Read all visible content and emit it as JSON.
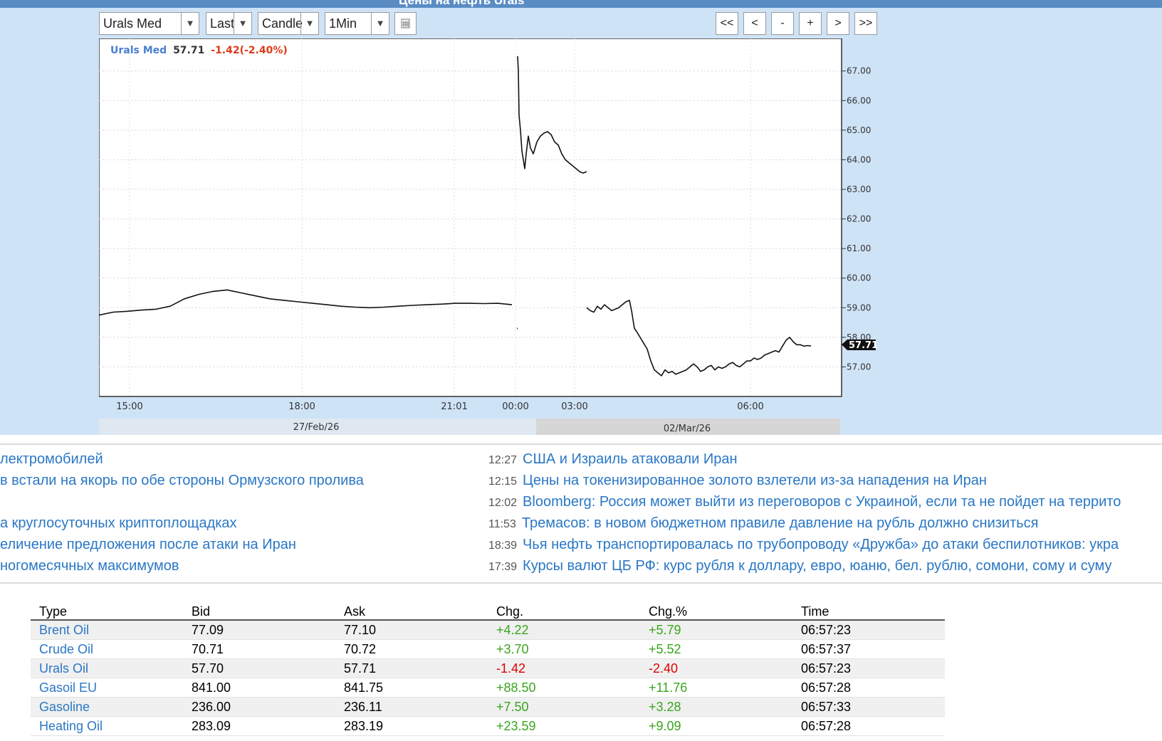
{
  "header": {
    "title": "Цены на нефть Urals"
  },
  "toolbar": {
    "instrument": "Urals Med",
    "price_field": "Last",
    "chart_style": "Candle",
    "interval": "1Min",
    "nav": {
      "first": "<<",
      "prev": "<",
      "zoom_out": "-",
      "zoom_in": "+",
      "next": ">",
      "last": ">>"
    }
  },
  "chart_data": {
    "type": "line",
    "series_name": "Urals Med",
    "last": "57.71",
    "change": "-1.42",
    "change_pct": "(-2.40%)",
    "last_label": "57.71",
    "ylim": [
      56.0,
      68.1
    ],
    "y_ticks": [
      "57.00",
      "58.00",
      "59.00",
      "60.00",
      "61.00",
      "62.00",
      "63.00",
      "64.00",
      "65.00",
      "66.00",
      "67.00"
    ],
    "x_ticks": [
      "15:00",
      "18:00",
      "21:01",
      "00:00",
      "03:00",
      "06:00"
    ],
    "date_labels": [
      "27/Feb/26",
      "02/Mar/26"
    ],
    "segments": [
      {
        "t": [
          0,
          20,
          40,
          60,
          80,
          100,
          120,
          140,
          160,
          180,
          200,
          220,
          240,
          260,
          280,
          300,
          320,
          340,
          360,
          380,
          400,
          420,
          440,
          460,
          480,
          500,
          520,
          540,
          560,
          580
        ],
        "v": [
          58.75,
          58.85,
          58.88,
          58.92,
          58.95,
          59.05,
          59.3,
          59.45,
          59.55,
          59.6,
          59.5,
          59.4,
          59.3,
          59.25,
          59.2,
          59.15,
          59.1,
          59.05,
          59.02,
          59.0,
          59.02,
          59.05,
          59.08,
          59.1,
          59.12,
          59.15,
          59.15,
          59.14,
          59.15,
          59.1
        ]
      },
      {
        "t": [
          587,
          587.5,
          588
        ],
        "v": [
          58.3,
          58.3,
          58.3
        ]
      },
      {
        "t": [
          588,
          589,
          590,
          592,
          594,
          596,
          598,
          600,
          603,
          606,
          610,
          615,
          620,
          625,
          630,
          635,
          640,
          645,
          650,
          655,
          660,
          665,
          670,
          675,
          680,
          685
        ],
        "v": [
          67.5,
          67.0,
          65.5,
          65.0,
          64.3,
          64.0,
          63.7,
          64.2,
          64.8,
          64.4,
          64.2,
          64.6,
          64.8,
          64.9,
          64.95,
          64.85,
          64.6,
          64.5,
          64.2,
          64.0,
          63.9,
          63.8,
          63.7,
          63.6,
          63.55,
          63.6
        ]
      },
      {
        "t": [
          685,
          690,
          695,
          700,
          705,
          710,
          715,
          720,
          725,
          730,
          735,
          740,
          745,
          748,
          750,
          752,
          755,
          760,
          765,
          770,
          775,
          780,
          785,
          790,
          795,
          800,
          805,
          810,
          815,
          820,
          825,
          830,
          835,
          840,
          845,
          850,
          855,
          860,
          865,
          870,
          875,
          880,
          885,
          890,
          895,
          900,
          905,
          910,
          915,
          920,
          925,
          930,
          935,
          940,
          945,
          950,
          955,
          960,
          965,
          970,
          975,
          980,
          985,
          990,
          995,
          1000
        ],
        "v": [
          59.0,
          58.9,
          58.85,
          59.05,
          58.95,
          59.1,
          59.0,
          58.9,
          58.95,
          59.0,
          59.1,
          59.2,
          59.25,
          58.9,
          58.6,
          58.3,
          58.2,
          58.0,
          57.8,
          57.6,
          57.2,
          56.9,
          56.8,
          56.7,
          56.9,
          56.8,
          56.85,
          56.75,
          56.8,
          56.85,
          56.9,
          57.0,
          57.1,
          57.0,
          56.85,
          56.9,
          57.0,
          57.05,
          56.9,
          57.0,
          56.95,
          57.0,
          57.1,
          57.15,
          57.05,
          57.0,
          57.1,
          57.2,
          57.2,
          57.3,
          57.25,
          57.3,
          57.4,
          57.45,
          57.5,
          57.55,
          57.5,
          57.7,
          57.9,
          58.0,
          57.85,
          57.75,
          57.75,
          57.7,
          57.72,
          57.71
        ]
      }
    ]
  },
  "news": {
    "left": [
      {
        "text": "лектромобилей"
      },
      {
        "text": "в встали на якорь по обе стороны Ормузского пролива"
      },
      {
        "text": "а круглосуточных криптоплощадках"
      },
      {
        "text": "еличение предложения после атаки на Иран"
      },
      {
        "text": "ногомесячных максимумов"
      }
    ],
    "right": [
      {
        "time": "12:27",
        "text": "США и Израиль атаковали Иран"
      },
      {
        "time": "12:15",
        "text": "Цены на токенизированное золото взлетели из-за нападения на Иран"
      },
      {
        "time": "12:02",
        "text": "Bloomberg: Россия может выйти из переговоров с Украиной, если та не пойдет на террито"
      },
      {
        "time": "11:53",
        "text": "Тремасов: в новом бюджетном правиле давление на рубль должно снизиться"
      },
      {
        "time": "18:39",
        "text": "Чья нефть транспортировалась по трубопроводу «Дружба» до атаки беспилотников: укра"
      },
      {
        "time": "17:39",
        "text": "Курсы валют ЦБ РФ: курс рубля к доллару, евро, юаню, бел. рублю, сомони, сому и суму"
      }
    ]
  },
  "quotes": {
    "headers": [
      "Type",
      "Bid",
      "Ask",
      "Chg.",
      "Chg.%",
      "Time"
    ],
    "rows": [
      {
        "name": "Brent Oil",
        "bid": "77.09",
        "ask": "77.10",
        "chg": "+4.22",
        "chg_pct": "+5.79",
        "time": "06:57:23",
        "sign": "pos"
      },
      {
        "name": "Crude Oil",
        "bid": "70.71",
        "ask": "70.72",
        "chg": "+3.70",
        "chg_pct": "+5.52",
        "time": "06:57:37",
        "sign": "pos"
      },
      {
        "name": "Urals Oil",
        "bid": "57.70",
        "ask": "57.71",
        "chg": "-1.42",
        "chg_pct": "-2.40",
        "time": "06:57:23",
        "sign": "neg"
      },
      {
        "name": "Gasoil EU",
        "bid": "841.00",
        "ask": "841.75",
        "chg": "+88.50",
        "chg_pct": "+11.76",
        "time": "06:57:28",
        "sign": "pos"
      },
      {
        "name": "Gasoline",
        "bid": "236.00",
        "ask": "236.11",
        "chg": "+7.50",
        "chg_pct": "+3.28",
        "time": "06:57:33",
        "sign": "pos"
      },
      {
        "name": "Heating Oil",
        "bid": "283.09",
        "ask": "283.19",
        "chg": "+23.59",
        "chg_pct": "+9.09",
        "time": "06:57:28",
        "sign": "pos"
      }
    ]
  }
}
